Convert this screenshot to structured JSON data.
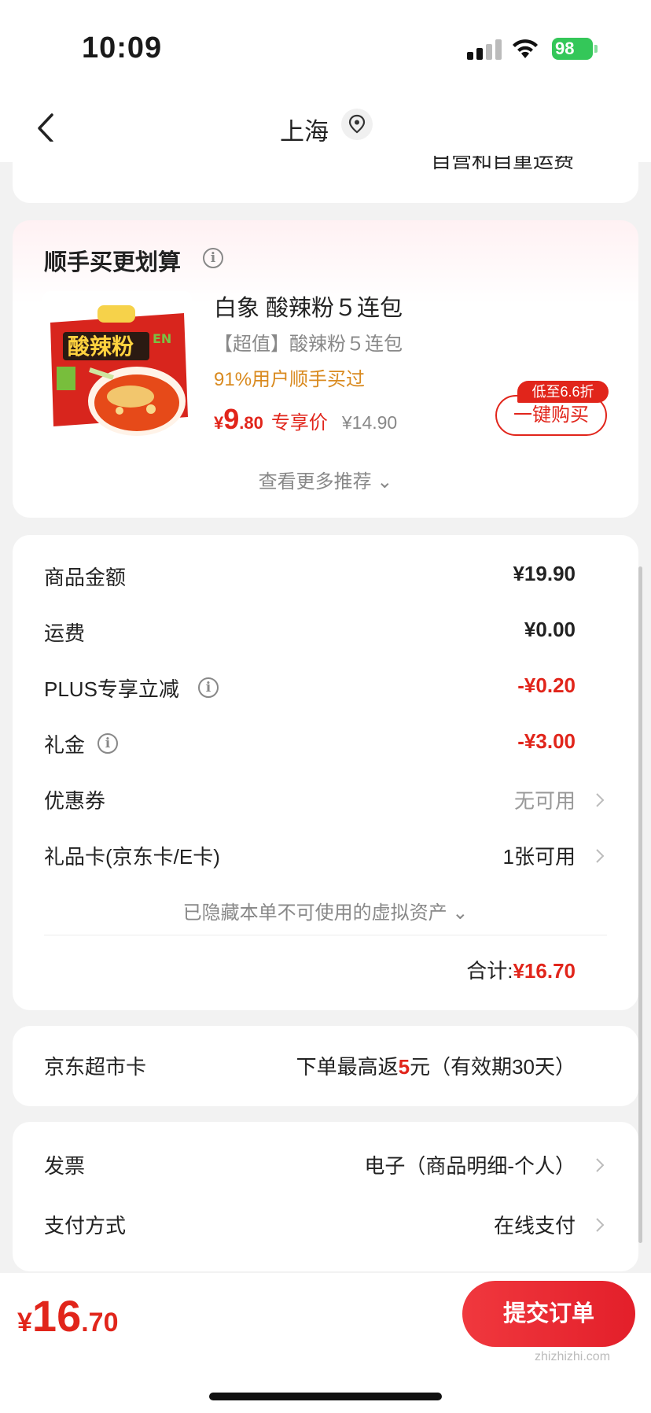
{
  "status": {
    "time": "10:09",
    "battery": "98"
  },
  "nav": {
    "title": "上海"
  },
  "prev": {
    "text": "自营和自重运费"
  },
  "recommend": {
    "title": "顺手买更划算",
    "product": {
      "name": "白象 酸辣粉５连包",
      "subtitle": "【超值】酸辣粉５连包",
      "rate": "91%用户顺手买过",
      "price_symbol": "¥",
      "price_int": "9",
      "price_dec": ".80",
      "price_tag": "专享价",
      "orig_price": "¥14.90",
      "discount": "低至6.6折",
      "buy_label": "一键购买"
    },
    "more": "查看更多推荐 ⌄"
  },
  "amounts": {
    "rows": [
      {
        "label": "商品金额",
        "value": "¥19.90"
      },
      {
        "label": "运费",
        "value": "¥0.00"
      },
      {
        "label": "PLUS专享立减",
        "value": "-¥0.20"
      },
      {
        "label": "礼金",
        "value": "-¥3.00"
      },
      {
        "label": "优惠券",
        "value": "无可用"
      },
      {
        "label": "礼品卡(京东卡/E卡)",
        "value": "1张可用"
      }
    ],
    "hidden_note": "已隐藏本单不可使用的虚拟资产 ⌄",
    "total_label": "合计:",
    "total_value": "¥16.70"
  },
  "jd_card": {
    "label": "京东超市卡",
    "value_pre": "下单最高返",
    "value_num": "5",
    "value_post": "元（有效期30天）"
  },
  "invoice": {
    "label": "发票",
    "value": "电子（商品明细-个人）"
  },
  "payment": {
    "label": "支付方式",
    "value": "在线支付"
  },
  "bottom": {
    "price_symbol": "¥",
    "price_int": "16",
    "price_dec": ".70",
    "submit_label": "提交订单"
  },
  "watermark": "zhizhizhi.com",
  "colors": {
    "accent": "#e1251b",
    "rate": "#d98a1f"
  }
}
